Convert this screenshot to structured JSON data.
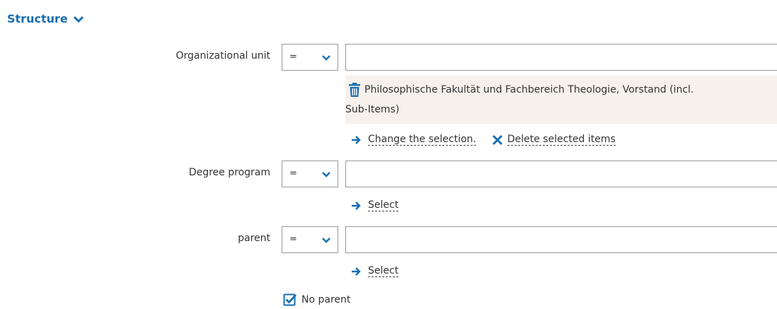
{
  "section": {
    "title": "Structure",
    "toggle_icon": "chevron-down-icon"
  },
  "colors": {
    "accent": "#1a6fb0",
    "selected_bg": "#f6f1ec",
    "border": "#9a9a9a"
  },
  "fields": {
    "org_unit": {
      "label": "Organizational unit",
      "operator": "=",
      "value": "",
      "selected_item_line1": "Philosophische Fakultät und Fachbereich Theologie, Vorstand (incl.",
      "selected_item_line2": "Sub-Items)",
      "change_label": "Change the selection.",
      "delete_label": "Delete selected items"
    },
    "degree_program": {
      "label": "Degree program",
      "operator": "=",
      "value": "",
      "select_label": "Select"
    },
    "parent": {
      "label": "parent",
      "operator": "=",
      "value": "",
      "select_label": "Select"
    }
  },
  "no_parent": {
    "label": "No parent",
    "checked": true
  }
}
